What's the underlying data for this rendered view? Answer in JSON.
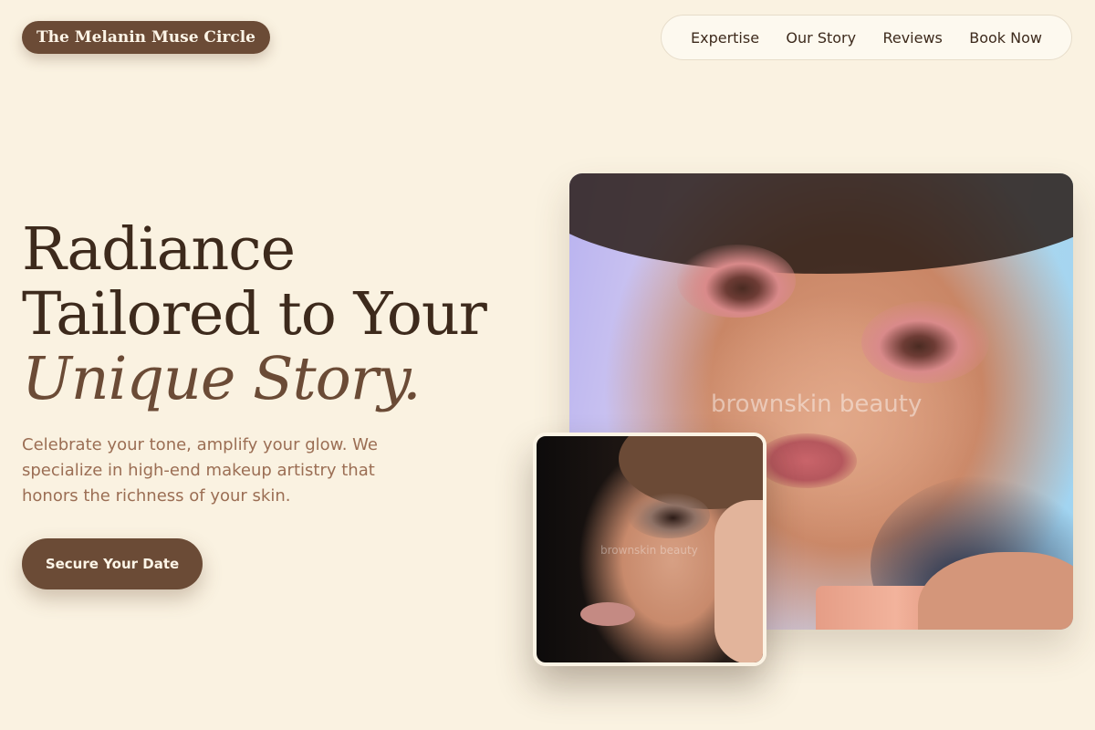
{
  "brand": {
    "name": "The Melanin Muse Circle"
  },
  "nav": {
    "items": [
      {
        "label": "Expertise"
      },
      {
        "label": "Our Story"
      },
      {
        "label": "Reviews"
      },
      {
        "label": "Book Now"
      }
    ]
  },
  "hero": {
    "headline_line1": "Radiance",
    "headline_line2": "Tailored to Your",
    "headline_accent": "Unique Story.",
    "subcopy": "Celebrate your tone, amplify your glow. We specialize in high-end makeup artistry that honors the richness of your skin.",
    "cta_label": "Secure Your Date"
  },
  "images": {
    "main_watermark": "brownskin beauty",
    "inset_watermark": "brownskin beauty"
  },
  "colors": {
    "background": "#faf2e1",
    "brand_brown": "#6b4b36",
    "text_dark": "#3d2a1c",
    "subcopy": "#9b6e54"
  }
}
